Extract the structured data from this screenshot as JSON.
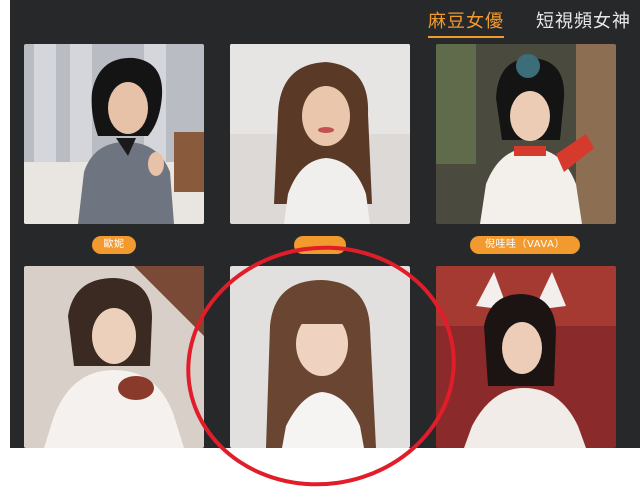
{
  "header": {
    "tabs": [
      {
        "label": "麻豆女優",
        "active": true
      },
      {
        "label": "短視頻女神",
        "active": false
      }
    ]
  },
  "grid": {
    "cards": [
      {
        "name": "歐妮",
        "photo": "woman-portrait-black-hair"
      },
      {
        "name": "",
        "photo": "woman-portrait-brown-hair"
      },
      {
        "name": "倪哇哇（VAVA）",
        "photo": "woman-portrait-hanfu"
      },
      {
        "name": "",
        "photo": "woman-portrait-white-top"
      },
      {
        "name": "",
        "photo": "woman-portrait-highlighted"
      },
      {
        "name": "",
        "photo": "woman-portrait-cat-ears"
      }
    ]
  },
  "colors": {
    "background": "#26282a",
    "accent": "#f29a2e",
    "highlight_circle": "#e11d2a"
  }
}
